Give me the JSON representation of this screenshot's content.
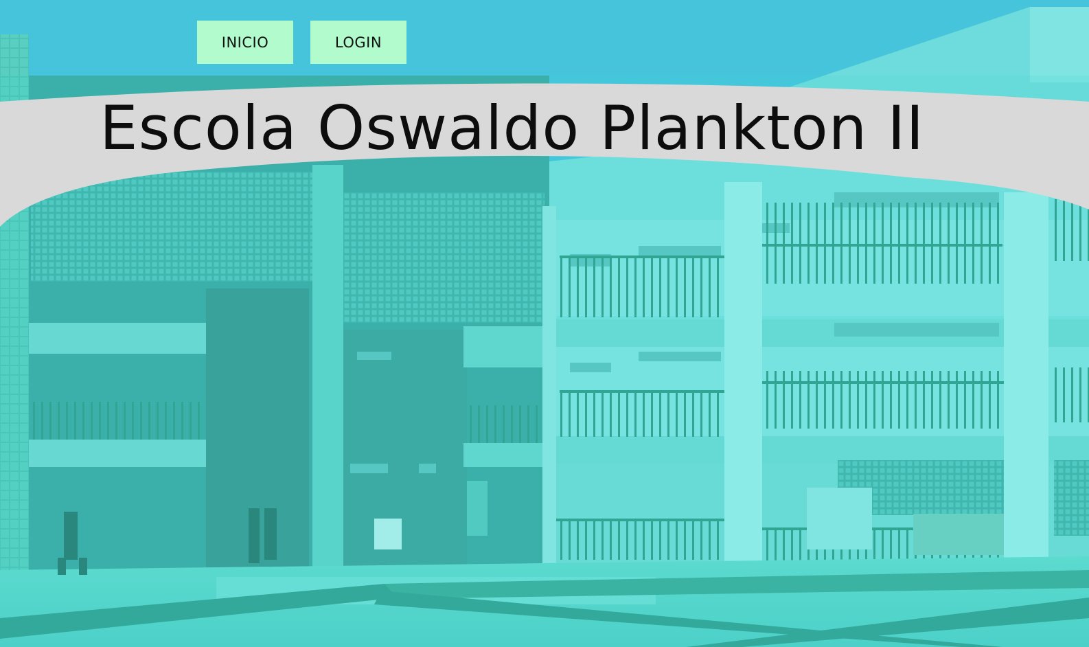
{
  "nav": {
    "items": [
      {
        "label": "INICIO"
      },
      {
        "label": "LOGIN"
      }
    ]
  },
  "header": {
    "title": "Escola Oswaldo Plankton II"
  },
  "colors": {
    "sky": "#45c4dc",
    "button_bg": "#b1fbcc",
    "banner_bg": "#d9d9d9",
    "photo_tint": "#40d8d0"
  }
}
